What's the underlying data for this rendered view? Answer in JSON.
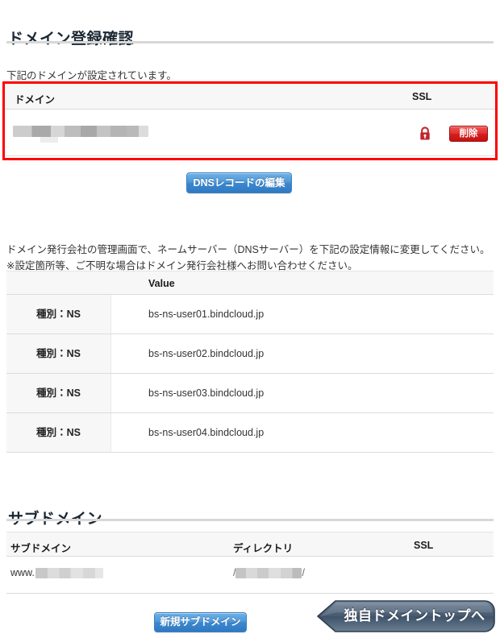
{
  "domain_section": {
    "title": "ドメイン登録確認",
    "lead": "下記のドメインが設定されています。",
    "table": {
      "headers": {
        "domain": "ドメイン",
        "ssl": "SSL"
      },
      "row": {
        "domain_value": "",
        "ssl_icon": "lock-icon",
        "delete_label": "削除"
      }
    },
    "dns_edit_button": "DNSレコードの編集"
  },
  "ns_section": {
    "notice_line1": "ドメイン発行会社の管理画面で、ネームサーバー（DNSサーバー）を下記の設定情報に変更してください。",
    "notice_line2": "※設定箇所等、ご不明な場合はドメイン発行会社様へお問い合わせください。",
    "table": {
      "headers": {
        "type": "",
        "value": "Value"
      },
      "rows": [
        {
          "type": "種別：NS",
          "value": "bs-ns-user01.bindcloud.jp"
        },
        {
          "type": "種別：NS",
          "value": "bs-ns-user02.bindcloud.jp"
        },
        {
          "type": "種別：NS",
          "value": "bs-ns-user03.bindcloud.jp"
        },
        {
          "type": "種別：NS",
          "value": "bs-ns-user04.bindcloud.jp"
        }
      ]
    }
  },
  "subdomain_section": {
    "title": "サブドメイン",
    "table": {
      "headers": {
        "subdomain": "サブドメイン",
        "directory": "ディレクトリ",
        "ssl": "SSL"
      },
      "rows": [
        {
          "subdomain_prefix": "www.",
          "subdomain_value": "",
          "directory_prefix": "/",
          "directory_value": "",
          "directory_suffix": "/",
          "ssl": ""
        }
      ]
    },
    "new_subdomain_button": "新規サブドメイン",
    "top_button": "独自ドメイントップへ"
  },
  "colors": {
    "highlight_border": "#fb0000",
    "primary_button": "#3c88cf",
    "danger_button": "#d41f1f",
    "arrow_button": "#495d73",
    "lock_icon": "#c1272d",
    "heading_text": "#1b2733",
    "table_header_bg": "#f7f7f7"
  }
}
